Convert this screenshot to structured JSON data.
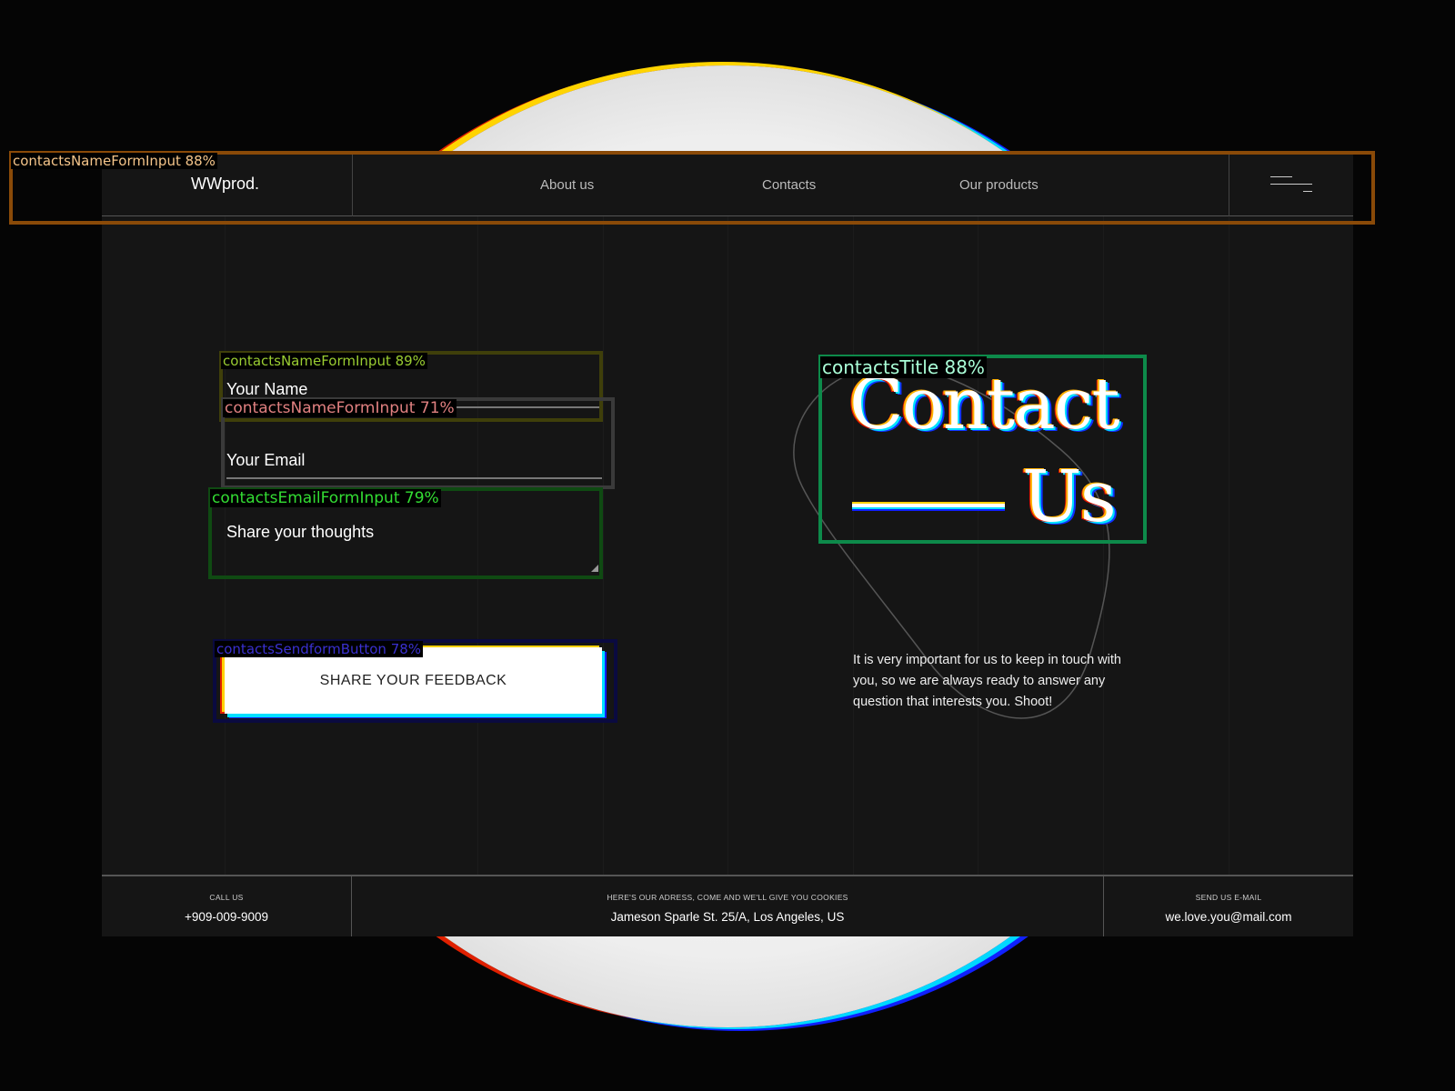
{
  "header": {
    "logo": "WWprod.",
    "nav": [
      {
        "label": "About us"
      },
      {
        "label": "Contacts"
      },
      {
        "label": "Our products"
      }
    ]
  },
  "form": {
    "name_placeholder": "Your Name",
    "email_placeholder": "Your Email",
    "thoughts_placeholder": "Share your thoughts",
    "submit_label": "SHARE YOUR FEEDBACK"
  },
  "hero": {
    "title_line1": "Contact",
    "title_line2": "Us",
    "description": "It is very important for us to keep in touch with you, so we are always ready to answer any question that interests you. Shoot!"
  },
  "footer": {
    "call": {
      "label": "CALL US",
      "value": "+909-009-9009"
    },
    "address": {
      "label": "HERE'S OUR ADRESS, COME AND WE'LL GIVE YOU COOKIES",
      "value": "Jameson Sparle St. 25/A, Los Angeles, US"
    },
    "email": {
      "label": "SEND US E-MAIL",
      "value": "we.love.you@mail.com"
    }
  },
  "detections": [
    {
      "label": "contactsNameFormInput 88%",
      "color": "#8a4a08",
      "text_color": "#f5c58a"
    },
    {
      "label": "contactsNameFormInput 89%",
      "color": "#3f3f0a",
      "text_color": "#9acd32"
    },
    {
      "label": "contactsNameFormInput 71%",
      "color": "#3a3a3a",
      "text_color": "#e08080"
    },
    {
      "label": "contactsEmailFormInput 79%",
      "color": "#0f4a12",
      "text_color": "#33dd33"
    },
    {
      "label": "contactsSendformButton 78%",
      "color": "#0a0a40",
      "text_color": "#3a30d0"
    },
    {
      "label": "contactsTitle 88%",
      "color": "#0d8a4a",
      "text_color": "#aaffd8"
    }
  ]
}
